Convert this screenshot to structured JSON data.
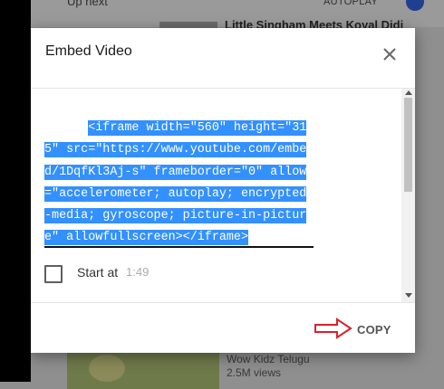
{
  "background": {
    "up_next_label": "Up next",
    "autoplay_label": "AUTOPLAY",
    "top_video_title": "Little Singham Meets Koyal Didi",
    "bottom_video_channel": "Wow Kidz Telugu",
    "bottom_video_views": "2.5M views"
  },
  "dialog": {
    "title": "Embed Video",
    "close_icon": "close-icon",
    "embed_code": "<iframe width=\"560\" height=\"315\" src=\"https://www.youtube.com/embed/1DqfKl3Aj-s\" frameborder=\"0\" allow=\"accelerometer; autoplay; encrypted-media; gyroscope; picture-in-picture\" allowfullscreen></iframe>",
    "embed_code_lines": [
      "<iframe width=\"560\" height=\"315\"",
      "src=\"https://www.youtube.com/embed/",
      "1DqfKl3Aj-s\" frameborder=\"0\"",
      "allow=\"accelerometer; autoplay;",
      "encrypted-media; gyroscope;",
      "picture-in-picture\"",
      "allowfullscreen></iframe>"
    ],
    "start_at_label": "Start at",
    "start_at_time": "1:49",
    "start_at_checked": false,
    "copy_label": "COPY"
  },
  "colors": {
    "selection": "#3390ff",
    "annotation_arrow": "#d9202a",
    "overlay": "#8f8f8f"
  }
}
